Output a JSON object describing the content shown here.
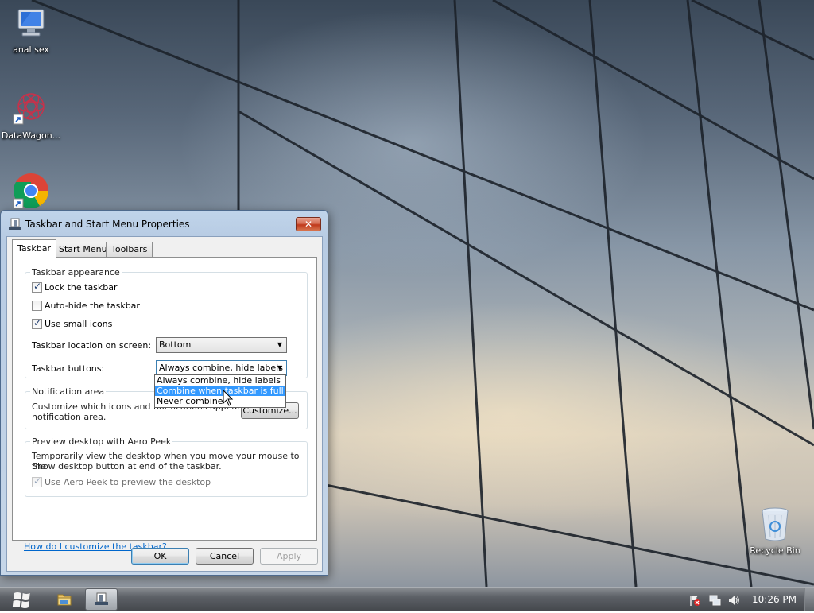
{
  "desktop": {
    "icons": [
      {
        "label": "anal sex",
        "icon": "computer-icon"
      },
      {
        "label": "DataWagon...",
        "icon": "datawagon-icon"
      },
      {
        "label": "",
        "icon": "chrome-icon"
      },
      {
        "label": "Recycle Bin",
        "icon": "recycle-bin-icon"
      }
    ]
  },
  "dialog": {
    "title": "Taskbar and Start Menu Properties",
    "close_label": "✕",
    "tabs": [
      {
        "label": "Taskbar",
        "active": true
      },
      {
        "label": "Start Menu",
        "active": false
      },
      {
        "label": "Toolbars",
        "active": false
      }
    ],
    "appearance": {
      "title": "Taskbar appearance",
      "lock": {
        "label": "Lock the taskbar",
        "checked": true
      },
      "autohide": {
        "label": "Auto-hide the taskbar",
        "checked": false
      },
      "small_icons": {
        "label": "Use small icons",
        "checked": true
      },
      "location_label": "Taskbar location on screen:",
      "location_value": "Bottom",
      "buttons_label": "Taskbar buttons:",
      "buttons_value": "Always combine, hide labels",
      "buttons_options": [
        "Always combine, hide labels",
        "Combine when taskbar is full",
        "Never combine"
      ],
      "highlighted_option": "Combine when taskbar is full"
    },
    "notification": {
      "title": "Notification area",
      "line1": "Customize which icons and notifications appear in the",
      "line2": "notification area.",
      "customize_label": "Customize..."
    },
    "aero_peek": {
      "title": "Preview desktop with Aero Peek",
      "line1": "Temporarily view the desktop when you move your mouse to the",
      "line2": "Show desktop button at end of the taskbar.",
      "checkbox_label": "Use Aero Peek to preview the desktop",
      "checked": true,
      "enabled": false
    },
    "help_link": "How do I customize the taskbar?",
    "ok_label": "OK",
    "cancel_label": "Cancel",
    "apply_label": "Apply"
  },
  "taskbar": {
    "clock": "10:26 PM",
    "pinned": [
      "file-explorer-icon",
      "taskbar-properties-icon"
    ],
    "tray_icons": [
      "action-center-flag-icon",
      "network-icon",
      "volume-icon"
    ]
  }
}
